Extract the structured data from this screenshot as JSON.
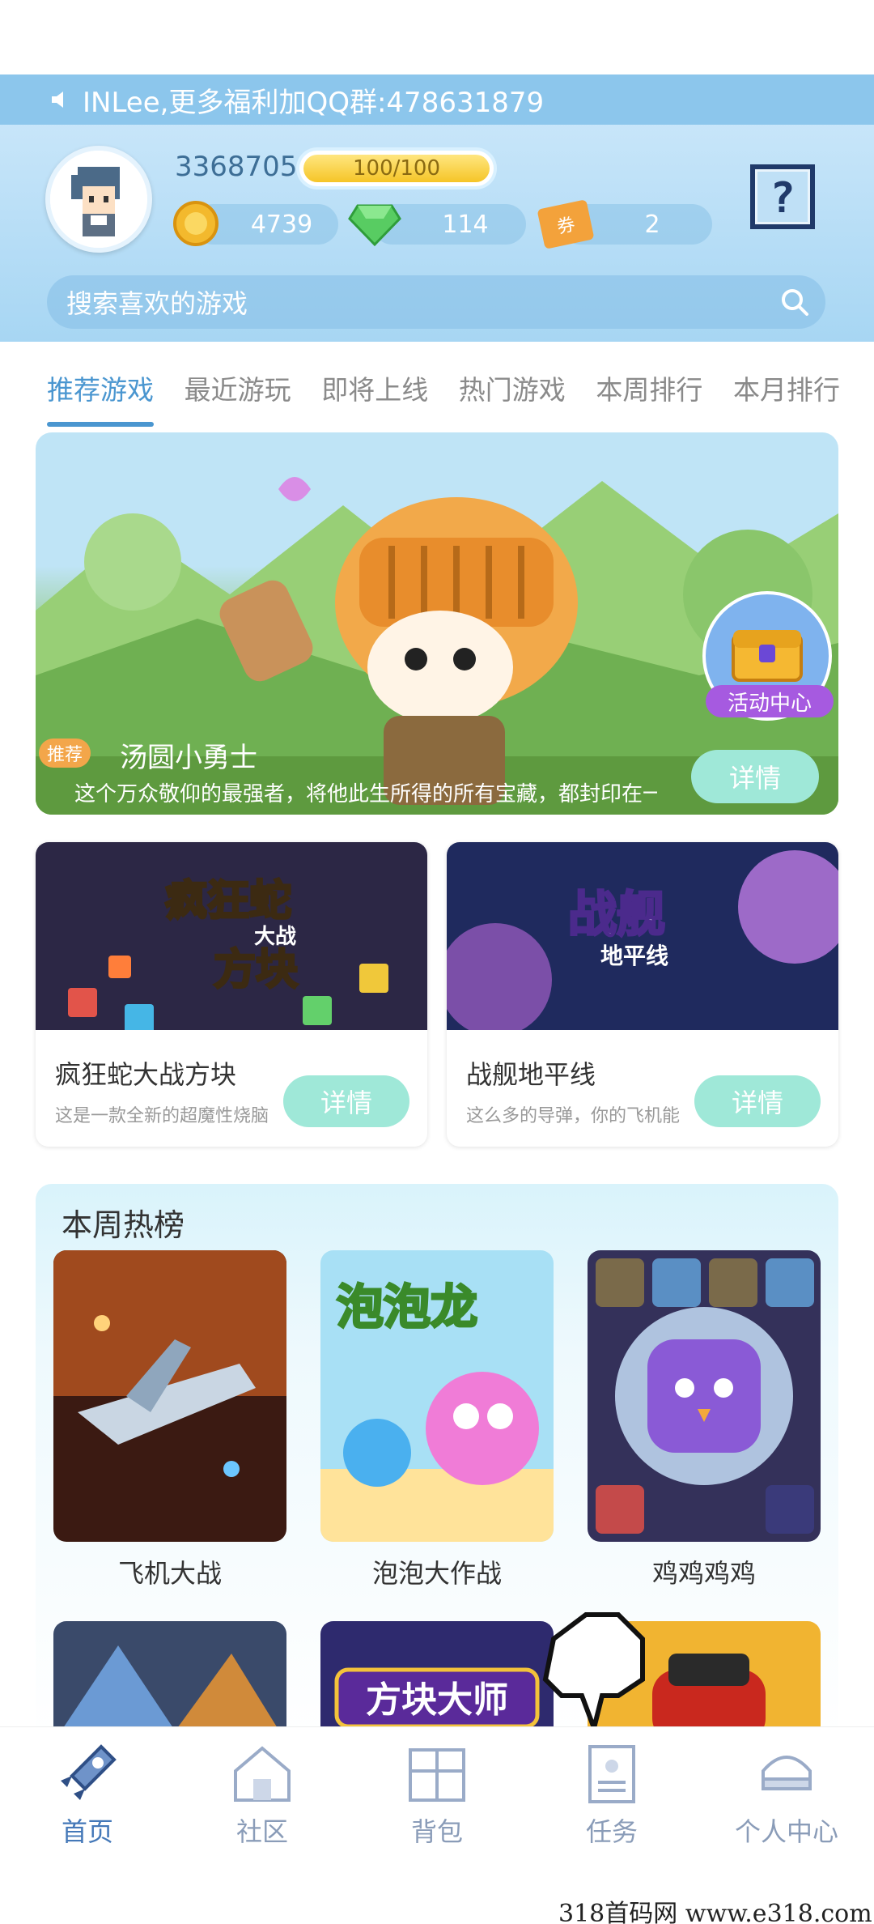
{
  "notice": {
    "text": "INLee,更多福利加QQ群:478631879"
  },
  "user": {
    "id": "3368705",
    "hp": "100/100",
    "coins": "4739",
    "gems": "114",
    "tickets": "2",
    "ticket_label": "券"
  },
  "search": {
    "placeholder": "搜索喜欢的游戏"
  },
  "tabs": [
    "推荐游戏",
    "最近游玩",
    "即将上线",
    "热门游戏",
    "本周排行",
    "本月排行"
  ],
  "banner": {
    "tag": "推荐",
    "title": "汤圆小勇士",
    "desc": "这个万众敬仰的最强者，将他此生所得的所有宝藏，都封印在一",
    "detail": "详情",
    "activity": "活动中心"
  },
  "cards": [
    {
      "name": "疯狂蛇大战方块",
      "desc": "这是一款全新的超魔性烧脑",
      "detail": "详情",
      "art_title": "疯狂蛇",
      "art_sub": "大战",
      "art_sub2": "方块"
    },
    {
      "name": "战舰地平线",
      "desc": "这么多的导弹，你的飞机能",
      "detail": "详情",
      "art_title": "战舰",
      "art_sub": "地平线"
    }
  ],
  "weekly": {
    "title": "本周热榜",
    "games": [
      {
        "name": "飞机大战"
      },
      {
        "name": "泡泡大作战",
        "art": "泡泡龙"
      },
      {
        "name": "鸡鸡鸡鸡"
      }
    ],
    "row2_art": "方块大师"
  },
  "nav": [
    {
      "label": "首页",
      "icon": "rocket-icon",
      "active": true
    },
    {
      "label": "社区",
      "icon": "house-icon"
    },
    {
      "label": "背包",
      "icon": "gift-icon"
    },
    {
      "label": "任务",
      "icon": "clipboard-icon"
    },
    {
      "label": "个人中心",
      "icon": "cap-icon"
    }
  ],
  "watermark": "318首码网  www.e318.com",
  "colors": {
    "accent": "#4a96d0",
    "detail_button": "#9fe8d8",
    "header": "#a7d6f3"
  }
}
